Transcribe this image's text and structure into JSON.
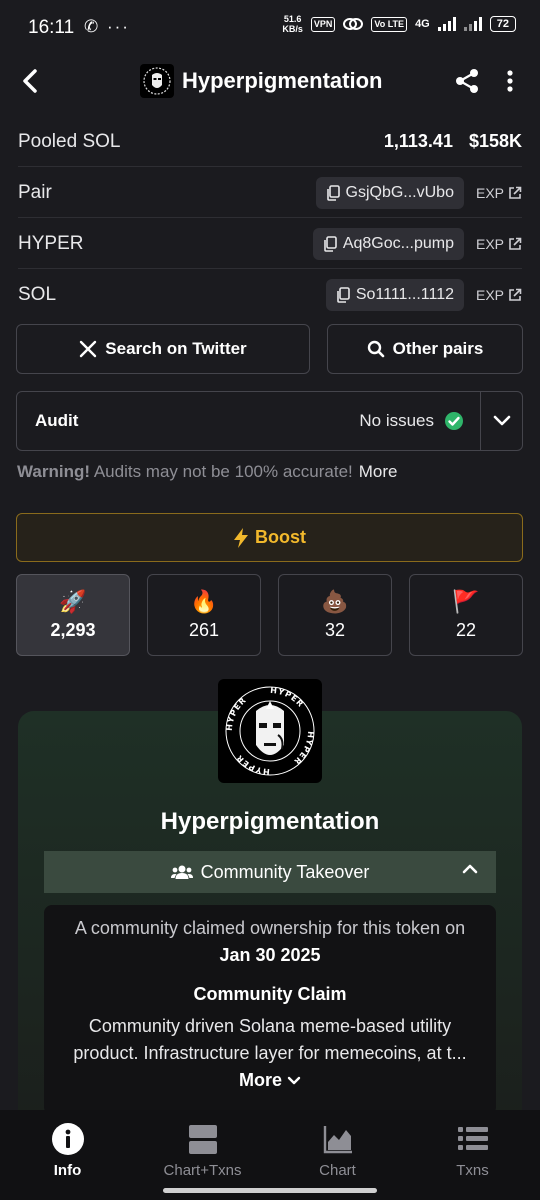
{
  "status_bar": {
    "time": "16:11",
    "left_icons": "✆ ···",
    "net_speed_top": "51.6",
    "net_speed_bottom": "KB/s",
    "vpn": "VPN",
    "volte": "Vo LTE",
    "network": "4G",
    "battery": "72"
  },
  "header": {
    "title": "Hyperpigmentation"
  },
  "info": {
    "pooled_label": "Pooled SOL",
    "pooled_amount": "1,113.41",
    "pooled_usd": "$158K",
    "rows": [
      {
        "label": "Pair",
        "address": "GsjQbG...vUbo",
        "exp": "EXP"
      },
      {
        "label": "HYPER",
        "address": "Aq8Goc...pump",
        "exp": "EXP"
      },
      {
        "label": "SOL",
        "address": "So1111...1112",
        "exp": "EXP"
      }
    ]
  },
  "actions": {
    "search_twitter": "Search on Twitter",
    "other_pairs": "Other pairs"
  },
  "audit": {
    "label": "Audit",
    "status": "No issues",
    "warning_strong": "Warning!",
    "warning_text": " Audits may not be 100% accurate!",
    "warning_more": "More"
  },
  "boost": {
    "label": "Boost",
    "accent": "#f2b92c"
  },
  "reactions": [
    {
      "emoji": "🚀",
      "count": "2,293",
      "icon": "rocket-icon"
    },
    {
      "emoji": "🔥",
      "count": "261",
      "icon": "fire-icon"
    },
    {
      "emoji": "💩",
      "count": "32",
      "icon": "poop-icon"
    },
    {
      "emoji": "🚩",
      "count": "22",
      "icon": "red-flag-icon"
    }
  ],
  "token_card": {
    "logo_text": "HYPER",
    "title": "Hyperpigmentation",
    "cto_label": "Community Takeover",
    "claim_intro": "A community claimed ownership for this token on ",
    "claim_date": "Jan 30 2025",
    "claim_heading": "Community Claim",
    "claim_desc": "Community driven Solana meme-based utility product. Infrastructure layer for memecoins, at t... ",
    "claim_more": "More"
  },
  "bottom_nav": [
    {
      "label": "Info",
      "icon": "info-icon",
      "active": true
    },
    {
      "label": "Chart+Txns",
      "icon": "chart-txns-icon",
      "active": false
    },
    {
      "label": "Chart",
      "icon": "chart-icon",
      "active": false
    },
    {
      "label": "Txns",
      "icon": "txns-list-icon",
      "active": false
    }
  ]
}
